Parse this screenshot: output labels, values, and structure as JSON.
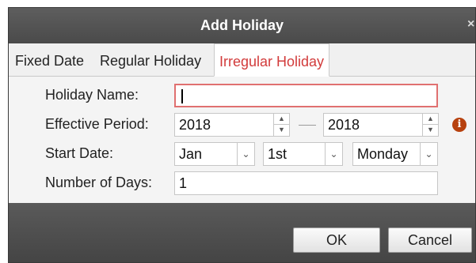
{
  "dialog": {
    "title": "Add Holiday",
    "close_glyph": "×"
  },
  "tabs": [
    {
      "label": "Fixed Date",
      "active": false
    },
    {
      "label": "Regular Holiday",
      "active": false
    },
    {
      "label": "Irregular Holiday",
      "active": true
    }
  ],
  "form": {
    "holiday_name": {
      "label": "Holiday Name:",
      "value": ""
    },
    "effective_period": {
      "label": "Effective Period:",
      "from": "2018",
      "to": "2018"
    },
    "start_date": {
      "label": "Start Date:",
      "month": "Jan",
      "week": "1st",
      "day": "Monday"
    },
    "number_of_days": {
      "label": "Number of Days:",
      "value": "1"
    }
  },
  "buttons": {
    "ok": "OK",
    "cancel": "Cancel"
  },
  "icons": {
    "info": "info-icon",
    "spin": "spin-up-down-icon",
    "dropdown": "chevron-down-icon",
    "close": "close-icon"
  },
  "colors": {
    "active_tab": "#d23b3b",
    "focus_border": "#e07070",
    "title_bar": "#555555",
    "info": "#b7410e"
  }
}
